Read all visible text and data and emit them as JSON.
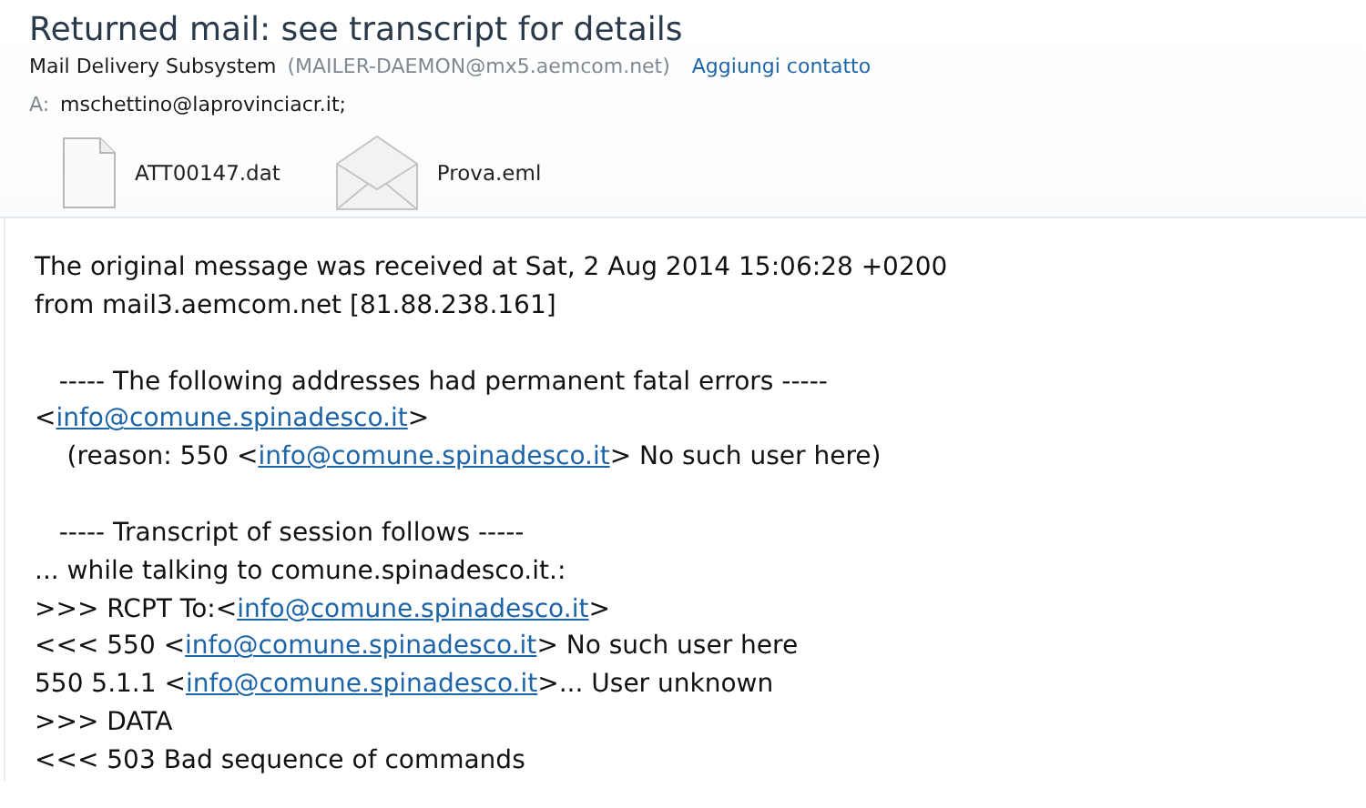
{
  "header": {
    "subject": "Returned mail: see transcript for details",
    "sender_name": "Mail Delivery Subsystem",
    "sender_address": "(MAILER-DAEMON@mx5.aemcom.net)",
    "add_contact": "Aggiungi contatto",
    "to_label": "A:",
    "to_address": "mschettino@laprovinciacr.it;"
  },
  "attachments": [
    {
      "kind": "file",
      "name": "ATT00147.dat"
    },
    {
      "kind": "mail",
      "name": "Prova.eml"
    }
  ],
  "body": [
    [
      [
        {
          "kind": "text",
          "text": "The original message was received at Sat, 2 Aug 2014 15:06:28 +0200"
        }
      ],
      [
        {
          "kind": "text",
          "text": "from mail3.aemcom.net [81.88.238.161]"
        }
      ]
    ],
    [
      [
        {
          "kind": "text",
          "text": "   ----- The following addresses had permanent fatal errors -----"
        }
      ],
      [
        {
          "kind": "text",
          "text": "<"
        },
        {
          "kind": "link",
          "text": "info@comune.spinadesco.it"
        },
        {
          "kind": "text",
          "text": ">"
        }
      ],
      [
        {
          "kind": "text",
          "text": "    (reason: 550 <"
        },
        {
          "kind": "link",
          "text": "info@comune.spinadesco.it"
        },
        {
          "kind": "text",
          "text": "> No such user here)"
        }
      ]
    ],
    [
      [
        {
          "kind": "text",
          "text": "   ----- Transcript of session follows -----"
        }
      ],
      [
        {
          "kind": "text",
          "text": "... while talking to comune.spinadesco.it.:"
        }
      ],
      [
        {
          "kind": "text",
          "text": ">>> RCPT To:<"
        },
        {
          "kind": "link",
          "text": "info@comune.spinadesco.it"
        },
        {
          "kind": "text",
          "text": ">"
        }
      ],
      [
        {
          "kind": "text",
          "text": "<<< 550 <"
        },
        {
          "kind": "link",
          "text": "info@comune.spinadesco.it"
        },
        {
          "kind": "text",
          "text": "> No such user here"
        }
      ],
      [
        {
          "kind": "text",
          "text": "550 5.1.1 <"
        },
        {
          "kind": "link",
          "text": "info@comune.spinadesco.it"
        },
        {
          "kind": "text",
          "text": ">... User unknown"
        }
      ],
      [
        {
          "kind": "text",
          "text": ">>> DATA"
        }
      ],
      [
        {
          "kind": "text",
          "text": "<<< 503 Bad sequence of commands"
        }
      ]
    ]
  ]
}
